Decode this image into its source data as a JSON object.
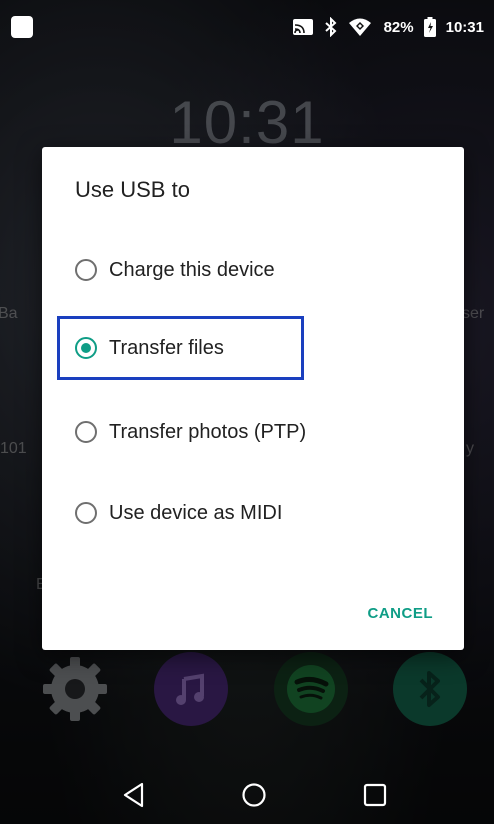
{
  "status_bar": {
    "battery_percent": "82%",
    "time": "10:31",
    "icons": [
      "notification-square-icon",
      "cast-icon",
      "bluetooth-icon",
      "wifi-icon",
      "battery-icon"
    ]
  },
  "home_screen": {
    "clock": "10:31",
    "partial_labels": [
      "Ba",
      "ser",
      "101",
      "y",
      "E"
    ],
    "dock_icons": [
      "settings-icon",
      "music-icon",
      "spotify-icon",
      "bluetooth-app-icon"
    ]
  },
  "dialog": {
    "title": "Use USB to",
    "options": [
      {
        "label": "Charge this device",
        "selected": false
      },
      {
        "label": "Transfer files",
        "selected": true
      },
      {
        "label": "Transfer photos (PTP)",
        "selected": false
      },
      {
        "label": "Use device as MIDI",
        "selected": false
      }
    ],
    "cancel_label": "CANCEL",
    "accent_color": "#0f9d86",
    "highlight_color": "#1a3fbf"
  },
  "nav_bar": {
    "buttons": [
      "back-icon",
      "home-icon",
      "recents-icon"
    ]
  }
}
